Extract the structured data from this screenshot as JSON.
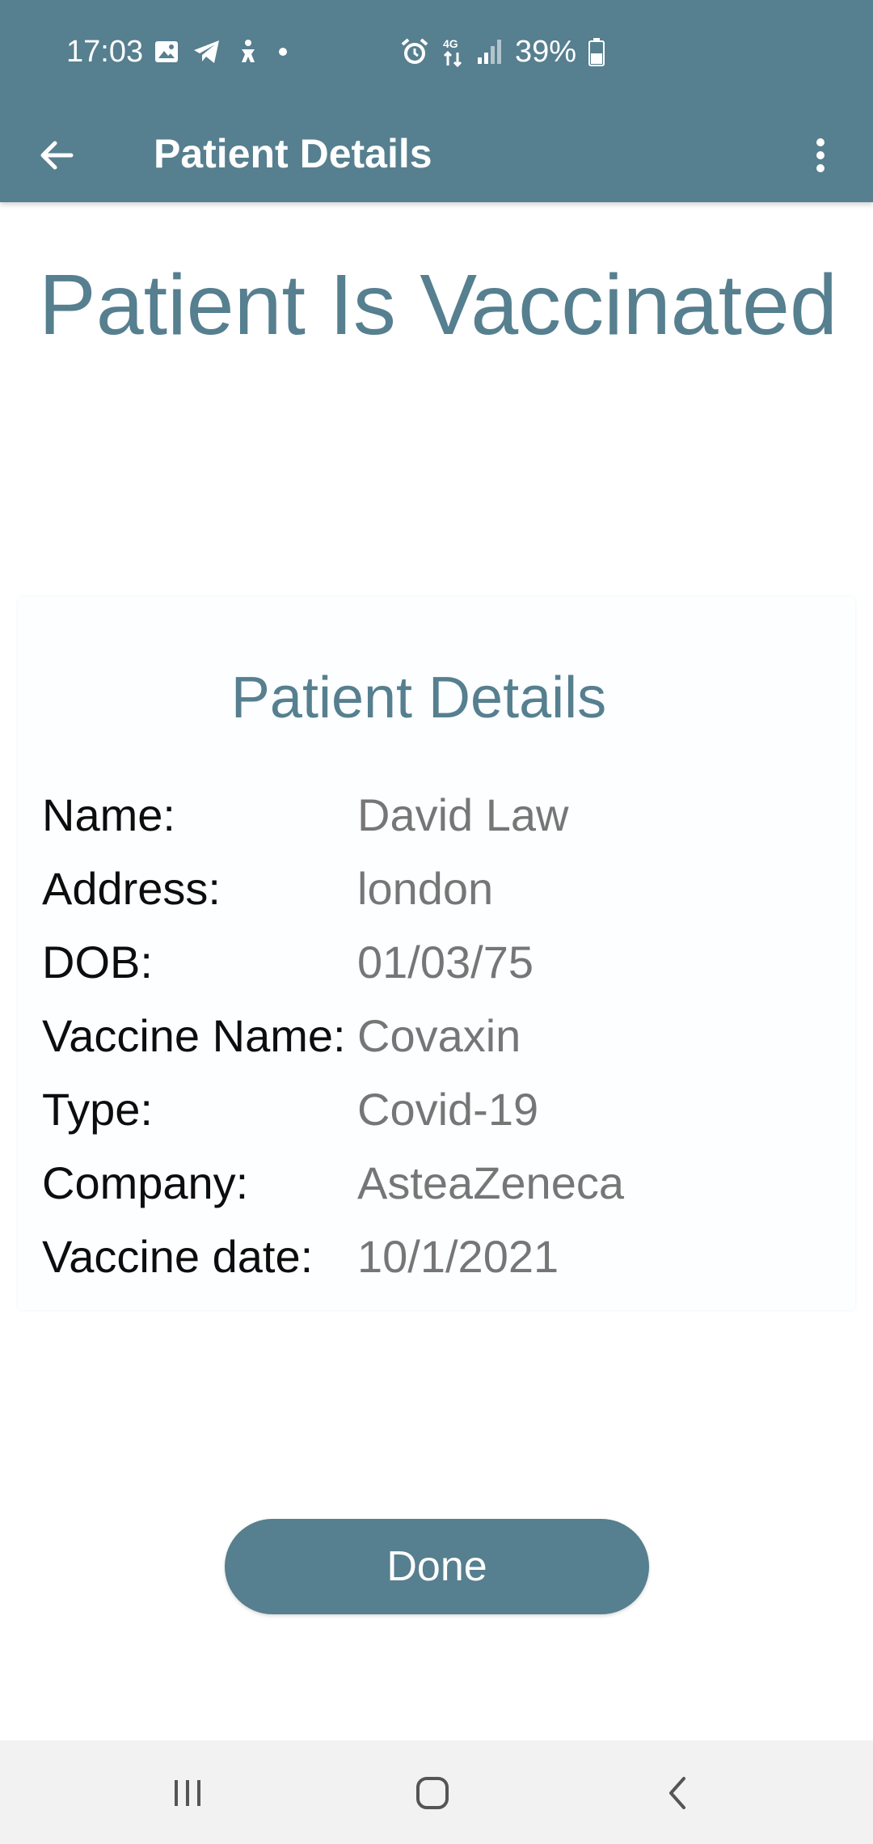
{
  "status_bar": {
    "time": "17:03",
    "icons_left": [
      "gallery-icon",
      "telegram-icon",
      "accessibility-icon",
      "notification-dot-icon"
    ],
    "icons_right": [
      "alarm-icon",
      "4g-data-icon",
      "signal-icon",
      "battery-icon"
    ],
    "battery": "39%"
  },
  "app_bar": {
    "title": "Patient Details",
    "back_icon": "arrow-left-icon",
    "more_icon": "more-vert-icon"
  },
  "headline": "Patient Is Vaccinated",
  "card": {
    "title": "Patient Details",
    "rows": [
      {
        "label": "Name:",
        "value": "David Law"
      },
      {
        "label": "Address:",
        "value": "london"
      },
      {
        "label": "DOB:",
        "value": "01/03/75"
      },
      {
        "label": "Vaccine Name:",
        "value": "Covaxin"
      },
      {
        "label": "Type:",
        "value": "Covid-19"
      },
      {
        "label": "Company:",
        "value": "AsteaZeneca"
      },
      {
        "label": "Vaccine date:",
        "value": "10/1/2021"
      }
    ]
  },
  "done_button": {
    "label": "Done"
  },
  "nav_bar": {
    "icons": [
      "recent-apps-icon",
      "home-icon",
      "back-icon"
    ]
  },
  "colors": {
    "primary": "#567f8f",
    "label_text": "#0d0d0d",
    "value_text": "#767676",
    "nav_bg": "#f2f2f2"
  }
}
